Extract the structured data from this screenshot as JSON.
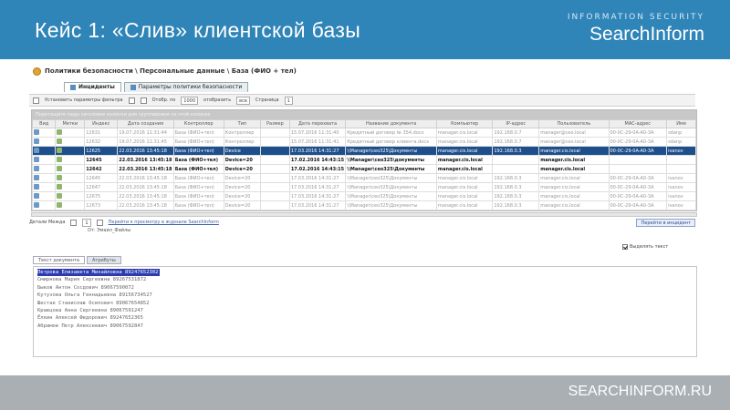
{
  "slide": {
    "title": "Кейс 1: «Слив» клиентской базы",
    "brand_top": "INFORMATION SECURITY",
    "brand": "SearchInform",
    "footer_url": "SEARCHINFORM.RU"
  },
  "app": {
    "breadcrumb": "Политики безопасности \\ Персональные данные \\ База (ФИО + тел)",
    "tabs": [
      {
        "label": "Инциденты"
      },
      {
        "label": "Параметры политики безопасности"
      }
    ],
    "toolbar": {
      "filter_label": "Установить параметры фильтра",
      "show_label": "Отобр. по",
      "show_value": "1000",
      "display_label": "отобразить",
      "display_value": "все",
      "page_label": "Страница",
      "page_value": "1"
    },
    "group_bar": "Перетащите сюда заголовок колонки для группировки по этой колонке",
    "columns": [
      "Вид",
      "Метки",
      "Индекс",
      "Дата создания",
      "Контроллер",
      "Тип",
      "Размер",
      "Дата перехвата",
      "Название документа",
      "Компьютер",
      "IP-адрес",
      "Пользователь",
      "MAC-адрес",
      "Имя"
    ],
    "rows": [
      {
        "style": "blurred",
        "cells": [
          "",
          "",
          "12631",
          "19.07.2016 11:31:44",
          "База (ФИО+тел)",
          "Контроллер",
          "",
          "15.07.2016 11:31:40",
          "Кредитный договор № 354.docx",
          "manager.cis.local",
          "192.168.0.7",
          "manager@ceo.local",
          "00-0C-29-0A-A0-3A",
          "sdanp"
        ]
      },
      {
        "style": "blurred",
        "cells": [
          "",
          "",
          "12632",
          "19.07.2016 11:31:45",
          "База (ФИО+тел)",
          "Контроллер",
          "",
          "15.07.2016 11:31:41",
          "Кредитный договор клиента.docx",
          "manager.cis.local",
          "192.168.0.7",
          "manager@ceo.local",
          "00-0C-29-0A-A0-3A",
          "sdanp"
        ]
      },
      {
        "style": "selected",
        "cells": [
          "",
          "",
          "12625",
          "22.03.2016 13:45:18",
          "База (ФИО+тел)",
          "Device",
          "",
          "17.03.2016 14:31:27",
          "\\\\Manager\\ceo325\\Документы",
          "manager.cis.local",
          "192.168.0.3",
          "manager.cis.local",
          "00-0C-29-0A-A0-3A",
          "ivanov"
        ]
      },
      {
        "style": "bold",
        "cells": [
          "",
          "",
          "12645",
          "22.03.2016 13:45:18",
          "База (ФИО+тел)",
          "Device=20",
          "",
          "17.02.2016 14:43:15",
          "\\\\Manager\\ceo325\\документы",
          "manager.cis.local",
          "",
          "manager.cis.local",
          "",
          ""
        ]
      },
      {
        "style": "bold",
        "cells": [
          "",
          "",
          "12642",
          "22.03.2016 13:45:18",
          "База (ФИО+тел)",
          "Device=20",
          "",
          "17.02.2016 14:43:15",
          "\\\\Manager\\ceo325\\Документы",
          "manager.cis.local",
          "",
          "manager.cis.local",
          "",
          ""
        ]
      },
      {
        "style": "blurred",
        "cells": [
          "",
          "",
          "12645",
          "22.03.2016 13:45:18",
          "База (ФИО+тел)",
          "Device=20",
          "",
          "17.03.2016 14:31:27",
          "\\\\Manager\\ceo325\\Документы",
          "manager.cis.local",
          "192.168.0.3",
          "manager.cis.local",
          "00-0C-29-0A-A0-3A",
          "ivanov"
        ]
      },
      {
        "style": "blurred",
        "cells": [
          "",
          "",
          "12647",
          "22.03.2016 13:45:18",
          "База (ФИО+тел)",
          "Device=20",
          "",
          "17.03.2016 14:31:27",
          "\\\\Manager\\ceo325\\Документы",
          "manager.cis.local",
          "192.168.0.3",
          "manager.cis.local",
          "00-0C-29-0A-A0-3A",
          "ivanov"
        ]
      },
      {
        "style": "blurred",
        "cells": [
          "",
          "",
          "12675",
          "22.03.2016 13:45:18",
          "База (ФИО+тел)",
          "Device=20",
          "",
          "17.03.2016 14:31:27",
          "\\\\Manager\\ceo325\\Документы",
          "manager.cis.local",
          "192.168.0.3",
          "manager.cis.local",
          "00-0C-29-0A-A0-3A",
          "ivanov"
        ]
      },
      {
        "style": "blurred",
        "cells": [
          "",
          "",
          "12673",
          "22.03.2016 13:45:18",
          "База (ФИО+тел)",
          "Device=20",
          "",
          "17.03.2016 14:31:27",
          "\\\\Manager\\ceo325\\Документы",
          "manager.cis.local",
          "192.168.0.3",
          "manager.cis.local",
          "00-0C-29-0A-A0-3A",
          "ivanov"
        ]
      }
    ],
    "detail": {
      "label": "Детали Межда",
      "page_value": "1",
      "link": "Перейти к просмотру в журнале SearchInform",
      "right_button": "Перейти в инцидент",
      "owner": "От: Эмаил_Файлы"
    },
    "checkbox_label": "Выделять текст",
    "subtabs": [
      "Текст документа",
      "Атрибуты"
    ],
    "content_lines": [
      "Петрова Елизавета Михайловна 89247652302",
      "Смирнова Мария Сергеевна 89267531872",
      "Быков Антон Сосдович 89067590072",
      "Кутузова Ольга Геннадьевна 89156734527",
      "Шестак Станислав Осипович 89067654852",
      "Кравцова Анна Сергеевна 89067591247",
      "Ёлкин Алексей Федорович 89247652365",
      "Абрамов Петр Алексеевич 89067592847"
    ]
  }
}
